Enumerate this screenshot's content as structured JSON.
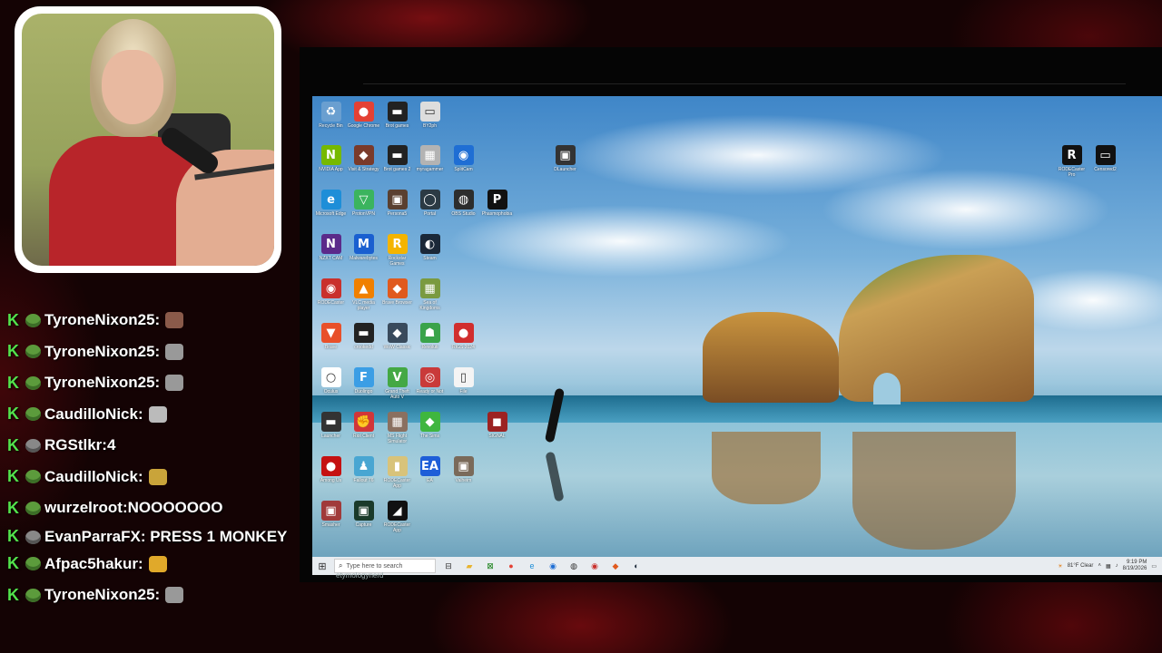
{
  "chat": {
    "messages": [
      {
        "user": "TyroneNixon25:",
        "text": "",
        "badge": "frog",
        "emote_color": "#8a5a4a"
      },
      {
        "user": "TyroneNixon25:",
        "text": "",
        "badge": "frog",
        "emote_color": "#999999"
      },
      {
        "user": "TyroneNixon25:",
        "text": "",
        "badge": "frog",
        "emote_color": "#999999"
      },
      {
        "user": "CaudilloNick:",
        "text": "",
        "badge": "frog",
        "emote_color": "#bbbbbb"
      },
      {
        "user": "RGStlkr:",
        "text": "4",
        "badge": "grey",
        "emote_color": ""
      },
      {
        "user": "CaudilloNick:",
        "text": "",
        "badge": "frog",
        "emote_color": "#c9a43a"
      },
      {
        "user": "wurzelroot:",
        "text": "NOOOOOOO",
        "badge": "frog",
        "emote_color": ""
      },
      {
        "user": "EvanParraFX:",
        "text": "PRESS 1 MONKEY",
        "badge": "grey",
        "emote_color": ""
      },
      {
        "user": "Afpac5hakur:",
        "text": "",
        "badge": "frog",
        "emote_color": "#e0a92a"
      },
      {
        "user": "TyroneNixon25:",
        "text": "",
        "badge": "frog",
        "emote_color": "#999999"
      }
    ]
  },
  "desktop": {
    "icons": [
      {
        "label": "Recycle Bin",
        "color": "#6a9fd0",
        "glyph": "♻"
      },
      {
        "label": "Google Chrome",
        "color": "#e44134",
        "glyph": "●"
      },
      {
        "label": "Brot games",
        "color": "#222222",
        "glyph": "▬"
      },
      {
        "label": "BY2ph",
        "color": "#dddddd",
        "glyph": "▭"
      },
      {
        "label": "NVIDIA App",
        "color": "#76b900",
        "glyph": "N"
      },
      {
        "label": "Visit & Strategy",
        "color": "#7a3a2a",
        "glyph": "◆"
      },
      {
        "label": "Brot games 2",
        "color": "#222222",
        "glyph": "▬"
      },
      {
        "label": "myragammer",
        "color": "#b3b3b3",
        "glyph": "▦"
      },
      {
        "label": "SplitCam",
        "color": "#1f6ed4",
        "glyph": "◉"
      },
      {
        "label": "Microsoft Edge",
        "color": "#1e8ed8",
        "glyph": "e"
      },
      {
        "label": "ProtonVPN",
        "color": "#3bb45e",
        "glyph": "▽"
      },
      {
        "label": "Persona5",
        "color": "#5a4030",
        "glyph": "▣"
      },
      {
        "label": "Portal",
        "color": "#2b3a44",
        "glyph": "◯"
      },
      {
        "label": "OBS Studio",
        "color": "#2d2d2d",
        "glyph": "◍"
      },
      {
        "label": "Phasmophobia",
        "color": "#111111",
        "glyph": "P"
      },
      {
        "label": "NZXT CAM",
        "color": "#5b2a8a",
        "glyph": "N"
      },
      {
        "label": "Malwarebytes",
        "color": "#1a5fd0",
        "glyph": "M"
      },
      {
        "label": "Rockstar Games",
        "color": "#f4b400",
        "glyph": "R"
      },
      {
        "label": "Steam",
        "color": "#1b2838",
        "glyph": "◐"
      },
      {
        "label": "RODECaster",
        "color": "#c9302c",
        "glyph": "◉"
      },
      {
        "label": "VLC media player",
        "color": "#f08000",
        "glyph": "▲"
      },
      {
        "label": "Brave Browser",
        "color": "#e05a1e",
        "glyph": "◆"
      },
      {
        "label": "Sea of Kingdoms",
        "color": "#7a9a40",
        "glyph": "▦"
      },
      {
        "label": "Brave",
        "color": "#e8502a",
        "glyph": "▼"
      },
      {
        "label": "crookedd",
        "color": "#222222",
        "glyph": "▬"
      },
      {
        "label": "WoW Classic",
        "color": "#394a5c",
        "glyph": "◆"
      },
      {
        "label": "Revoluti",
        "color": "#3aa34a",
        "glyph": "☗"
      },
      {
        "label": "RIGS 2024",
        "color": "#d12e2e",
        "glyph": "●"
      },
      {
        "label": "Oculus",
        "color": "#ffffff",
        "glyph": "○"
      },
      {
        "label": "Duolingo",
        "color": "#3b9ee5",
        "glyph": "F"
      },
      {
        "label": "Grand Theft Auto V",
        "color": "#44a844",
        "glyph": "V"
      },
      {
        "label": "Ready or Not",
        "color": "#c93a3a",
        "glyph": "◎"
      },
      {
        "label": "File",
        "color": "#f4f4f4",
        "glyph": "▯"
      },
      {
        "label": "Launcher",
        "color": "#333333",
        "glyph": "▬"
      },
      {
        "label": "Riot Client",
        "color": "#d13639",
        "glyph": "✊"
      },
      {
        "label": "MS Flight Simulator",
        "color": "#8a7060",
        "glyph": "▦"
      },
      {
        "label": "The Sims",
        "color": "#3fb63f",
        "glyph": "◆"
      },
      {
        "label": "SIGNAL",
        "color": "#9c2222",
        "glyph": "◼"
      },
      {
        "label": "Among Us",
        "color": "#c51111",
        "glyph": "●"
      },
      {
        "label": "Fallout 76",
        "color": "#49a6d2",
        "glyph": "♟"
      },
      {
        "label": "RODECaster App",
        "color": "#d8c37a",
        "glyph": "▮"
      },
      {
        "label": "EA",
        "color": "#1e5ed8",
        "glyph": "EA"
      },
      {
        "label": "Valheim",
        "color": "#7a6a5a",
        "glyph": "▣"
      },
      {
        "label": "Smasher",
        "color": "#a03a3a",
        "glyph": "▣"
      },
      {
        "label": "Capture",
        "color": "#1a3a2a",
        "glyph": "▣"
      },
      {
        "label": "RODECaster App",
        "color": "#111111",
        "glyph": "◢"
      },
      {
        "label": "DLauncher",
        "color": "#333333",
        "glyph": "▣"
      },
      {
        "label": "RODECaster Pro",
        "color": "#111111",
        "glyph": "R"
      },
      {
        "label": "Censored2",
        "color": "#111111",
        "glyph": "▭"
      }
    ]
  },
  "taskbar": {
    "search_placeholder": "Type here to search",
    "weather": "81°F Clear",
    "time": "9:19 PM",
    "date": "8/19/2026",
    "pinned": [
      {
        "name": "task-view-icon",
        "glyph": "⊟",
        "color": "#333333"
      },
      {
        "name": "file-explorer-icon",
        "glyph": "▰",
        "color": "#e8b430"
      },
      {
        "name": "xbox-icon",
        "glyph": "⊠",
        "color": "#107c10"
      },
      {
        "name": "chrome-icon",
        "glyph": "●",
        "color": "#e44134"
      },
      {
        "name": "edge-icon",
        "glyph": "e",
        "color": "#1e8ed8"
      },
      {
        "name": "splitcam-icon",
        "glyph": "◉",
        "color": "#1f6ed4"
      },
      {
        "name": "obs-icon",
        "glyph": "◍",
        "color": "#2d2d2d"
      },
      {
        "name": "rodecaster-icon",
        "glyph": "◉",
        "color": "#c9302c"
      },
      {
        "name": "brave-icon",
        "glyph": "◆",
        "color": "#e05a1e"
      },
      {
        "name": "steam-icon",
        "glyph": "◐",
        "color": "#1b2838"
      }
    ]
  },
  "overlay": {
    "username": "etymologynerd"
  }
}
